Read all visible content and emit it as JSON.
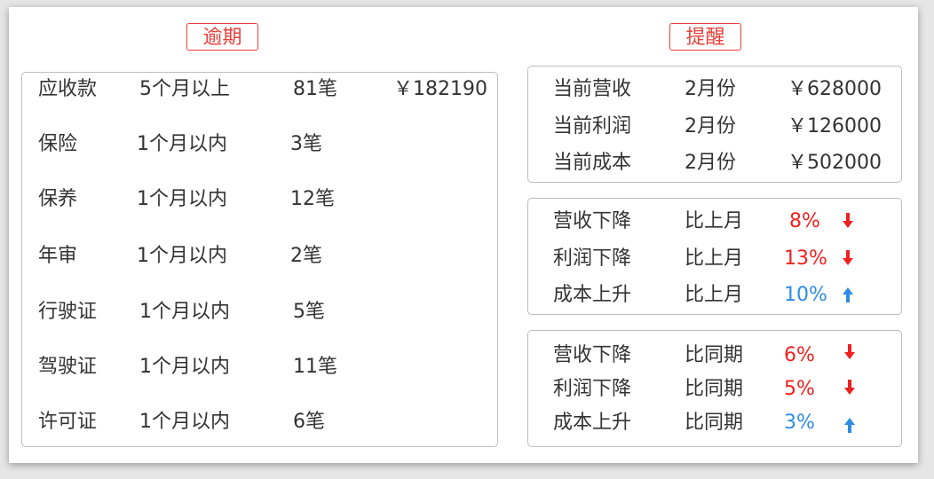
{
  "colors": {
    "accent_red": "#f0211f",
    "accent_blue": "#2e8ce6",
    "border": "#bdbdbd"
  },
  "overdue": {
    "title": "逾期",
    "rows": [
      {
        "name": "应收款",
        "period": "5个月以上",
        "count": "81笔",
        "amount": "￥182190"
      },
      {
        "name": "保险",
        "period": "1个月以内",
        "count": "3笔",
        "amount": ""
      },
      {
        "name": "保养",
        "period": "1个月以内",
        "count": "12笔",
        "amount": ""
      },
      {
        "name": "年审",
        "period": "1个月以内",
        "count": "2笔",
        "amount": ""
      },
      {
        "name": "行驶证",
        "period": "1个月以内",
        "count": "5笔",
        "amount": ""
      },
      {
        "name": "驾驶证",
        "period": "1个月以内",
        "count": "11笔",
        "amount": ""
      },
      {
        "name": "许可证",
        "period": "1个月以内",
        "count": "6笔",
        "amount": ""
      }
    ]
  },
  "reminder": {
    "title": "提醒",
    "current": [
      {
        "label": "当前营收",
        "month": "2月份",
        "amount": "￥628000"
      },
      {
        "label": "当前利润",
        "month": "2月份",
        "amount": "￥126000"
      },
      {
        "label": "当前成本",
        "month": "2月份",
        "amount": "￥502000"
      }
    ],
    "month_over_month": [
      {
        "label": "营收下降",
        "basis": "比上月",
        "percent": "8%",
        "direction": "down",
        "icon": "arrow-down-icon"
      },
      {
        "label": "利润下降",
        "basis": "比上月",
        "percent": "13%",
        "direction": "down",
        "icon": "arrow-down-icon"
      },
      {
        "label": "成本上升",
        "basis": "比上月",
        "percent": "10%",
        "direction": "up",
        "icon": "arrow-up-icon"
      }
    ],
    "year_over_year": [
      {
        "label": "营收下降",
        "basis": "比同期",
        "percent": "6%",
        "direction": "down",
        "icon": "arrow-down-icon"
      },
      {
        "label": "利润下降",
        "basis": "比同期",
        "percent": "5%",
        "direction": "down",
        "icon": "arrow-down-icon"
      },
      {
        "label": "成本上升",
        "basis": "比同期",
        "percent": "3%",
        "direction": "up",
        "icon": "arrow-up-icon"
      }
    ]
  }
}
